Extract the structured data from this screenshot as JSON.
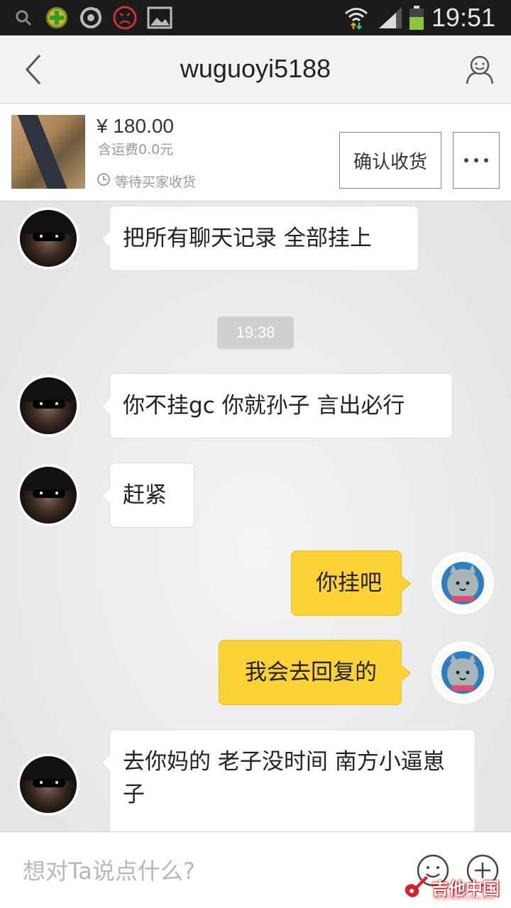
{
  "status_bar": {
    "time": "19:51",
    "icons": [
      "search-icon",
      "plus-badge-icon",
      "weibo-icon",
      "sad-face-icon",
      "image-icon",
      "wifi-icon",
      "signal-icon",
      "battery-icon"
    ]
  },
  "header": {
    "title": "wuguoyi5188",
    "back_icon": "chevron-left-icon",
    "profile_icon": "person-icon"
  },
  "order": {
    "price": "¥ 180.00",
    "shipping": "含运费0.0元",
    "status": "等待买家收货",
    "confirm_label": "确认收货",
    "more_label": "···"
  },
  "messages": [
    {
      "side": "left",
      "text": "把所有聊天记录 全部挂上"
    },
    {
      "side": "time",
      "text": "19:38"
    },
    {
      "side": "left",
      "text": "你不挂gc 你就孙子 言出必行"
    },
    {
      "side": "left",
      "text": "赶紧"
    },
    {
      "side": "right",
      "text": "你挂吧"
    },
    {
      "side": "right",
      "text": "我会去回复的"
    },
    {
      "side": "left",
      "text": "去你妈的 老子没时间 南方小逼崽子"
    }
  ],
  "input": {
    "placeholder": "想对Ta说点什么?"
  },
  "watermark": {
    "text": "吉他中国",
    "sub": "bbs.GuitarChina.com"
  },
  "colors": {
    "accent_bubble": "#fcd237",
    "status_bar_bg": "#1b1b1b"
  }
}
